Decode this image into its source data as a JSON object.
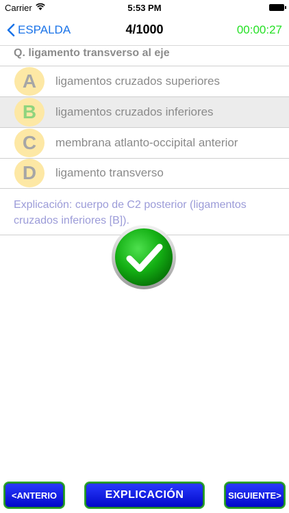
{
  "status_bar": {
    "carrier": "Carrier",
    "time": "5:53 PM"
  },
  "nav": {
    "back_label": "ESPALDA",
    "counter": "4/1000",
    "timer": "00:00:27"
  },
  "question": "Q. ligamento transverso al eje",
  "options": [
    {
      "letter": "A",
      "text": "ligamentos cruzados superiores",
      "selected": false
    },
    {
      "letter": "B",
      "text": "ligamentos cruzados inferiores",
      "selected": true
    },
    {
      "letter": "C",
      "text": "membrana atlanto-occipital anterior",
      "selected": false
    },
    {
      "letter": "D",
      "text": "ligamento transverso",
      "selected": false
    }
  ],
  "explanation": "Explicación: cuerpo de C2 posterior (ligamentos cruzados inferiores [B]).",
  "result_icon": "checkmark-correct-icon",
  "buttons": {
    "prev": "<ANTERIO",
    "explain": "EXPLICACIÓN",
    "next": "SIGUIENTE>"
  },
  "colors": {
    "accent_blue": "#1a73e8",
    "timer_green": "#24e024",
    "bubble": "#fde8a5",
    "button_blue": "#1a2cf0",
    "explanation_text": "#9b9bd8"
  }
}
